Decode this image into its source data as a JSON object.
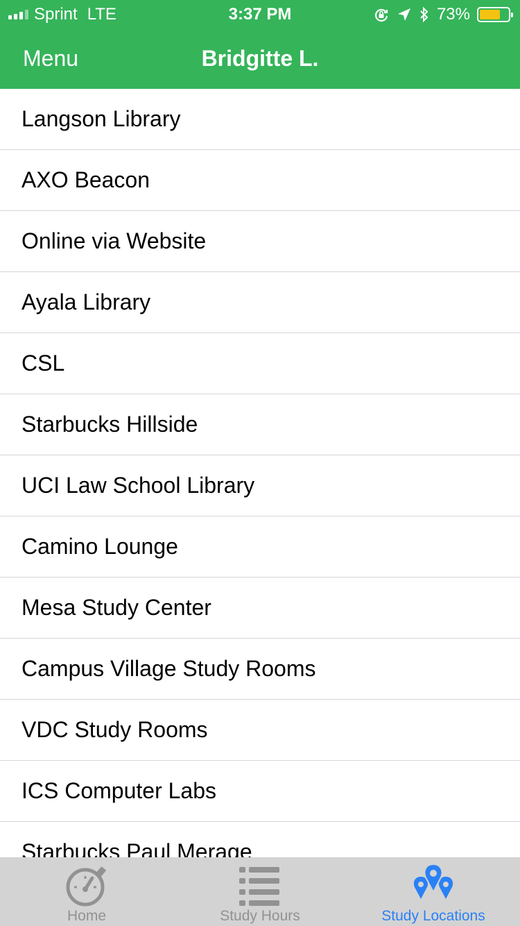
{
  "status_bar": {
    "carrier": "Sprint",
    "network": "LTE",
    "time": "3:37 PM",
    "battery_percent": "73%",
    "battery_level": 0.73,
    "battery_color": "#f4c211"
  },
  "nav": {
    "menu_label": "Menu",
    "title": "Bridgitte L.",
    "background_color": "#35b45a"
  },
  "locations": [
    {
      "name": "Langson Library"
    },
    {
      "name": "AXO Beacon"
    },
    {
      "name": "Online via Website"
    },
    {
      "name": "Ayala Library"
    },
    {
      "name": "CSL"
    },
    {
      "name": "Starbucks Hillside"
    },
    {
      "name": "UCI Law School Library"
    },
    {
      "name": "Camino Lounge"
    },
    {
      "name": "Mesa Study Center"
    },
    {
      "name": "Campus Village Study Rooms"
    },
    {
      "name": "VDC Study Rooms"
    },
    {
      "name": "ICS Computer Labs"
    },
    {
      "name": "Starbucks Paul Merage"
    }
  ],
  "tabs": [
    {
      "label": "Home",
      "icon": "stopwatch-icon",
      "active": false
    },
    {
      "label": "Study Hours",
      "icon": "list-icon",
      "active": false
    },
    {
      "label": "Study Locations",
      "icon": "map-pins-icon",
      "active": true
    }
  ],
  "colors": {
    "active_tab": "#2a81f6",
    "inactive_tab": "#929292",
    "tab_bar_bg": "#d3d3d3"
  }
}
